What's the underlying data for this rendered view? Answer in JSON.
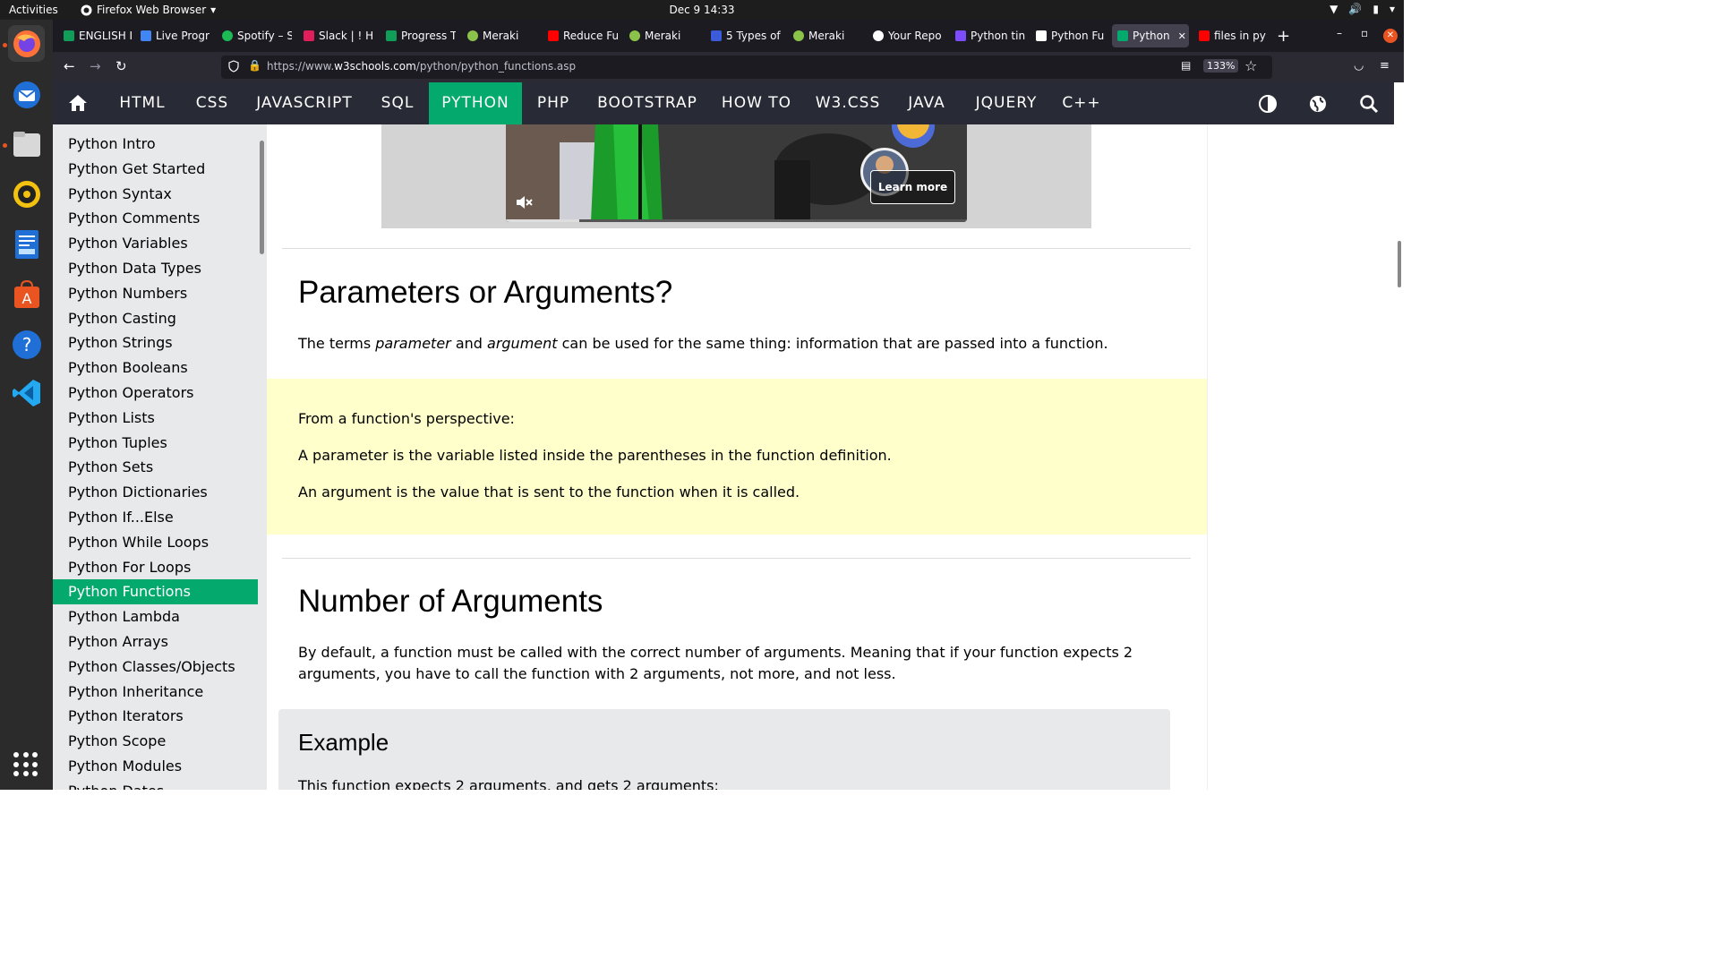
{
  "system": {
    "activities": "Activities",
    "app_name": "Firefox Web Browser",
    "clock": "Dec 9  14:33"
  },
  "tabs": [
    {
      "label": "ENGLISH I",
      "color": "#0f9d58"
    },
    {
      "label": "Live Progr",
      "color": "#4285f4"
    },
    {
      "label": "Spotify – S",
      "color": "#1db954"
    },
    {
      "label": "Slack | ! Hi",
      "color": "#e01e5a"
    },
    {
      "label": "Progress T",
      "color": "#0f9d58"
    },
    {
      "label": "Meraki",
      "color": "#8bc34a"
    },
    {
      "label": "Reduce Fu",
      "color": "#ff0000"
    },
    {
      "label": "Meraki",
      "color": "#8bc34a"
    },
    {
      "label": "5 Types of",
      "color": "#3b5bdb"
    },
    {
      "label": "Meraki",
      "color": "#8bc34a"
    },
    {
      "label": "Your Repo",
      "color": "#ffffff"
    },
    {
      "label": "Python tin",
      "color": "#7c4dff"
    },
    {
      "label": "Python Fu",
      "color": "#ffffff"
    },
    {
      "label": "Python",
      "color": "#04aa6d"
    },
    {
      "label": "files in py",
      "color": "#ff0000"
    }
  ],
  "address": {
    "url_prefix": "https://www.",
    "url_domain": "w3schools.com",
    "url_path": "/python/python_functions.asp",
    "zoom": "133%"
  },
  "w3nav": {
    "items": [
      "HTML",
      "CSS",
      "JAVASCRIPT",
      "SQL",
      "PYTHON",
      "PHP",
      "BOOTSTRAP",
      "HOW TO",
      "W3.CSS",
      "JAVA",
      "JQUERY",
      "C++"
    ],
    "active": "PYTHON"
  },
  "sidebar": {
    "items": [
      "Python Intro",
      "Python Get Started",
      "Python Syntax",
      "Python Comments",
      "Python Variables",
      "Python Data Types",
      "Python Numbers",
      "Python Casting",
      "Python Strings",
      "Python Booleans",
      "Python Operators",
      "Python Lists",
      "Python Tuples",
      "Python Sets",
      "Python Dictionaries",
      "Python If...Else",
      "Python While Loops",
      "Python For Loops",
      "Python Functions",
      "Python Lambda",
      "Python Arrays",
      "Python Classes/Objects",
      "Python Inheritance",
      "Python Iterators",
      "Python Scope",
      "Python Modules",
      "Python Dates"
    ],
    "active": "Python Functions"
  },
  "ad": {
    "learn_more": "Learn more"
  },
  "content": {
    "section1_title": "Parameters or Arguments?",
    "section1_p_pre": "The terms ",
    "section1_p_em1": "parameter",
    "section1_p_mid": " and ",
    "section1_p_em2": "argument",
    "section1_p_post": " can be used for the same thing: information that are passed into a function.",
    "note_1": "From a function's perspective:",
    "note_2": "A parameter is the variable listed inside the parentheses in the function definition.",
    "note_3": "An argument is the value that is sent to the function when it is called.",
    "section2_title": "Number of Arguments",
    "section2_p": "By default, a function must be called with the correct number of arguments. Meaning that if your function expects 2 arguments, you have to call the function with 2 arguments, not more, and not less.",
    "example_title": "Example",
    "example_text": "This function expects 2 arguments, and gets 2 arguments:"
  }
}
